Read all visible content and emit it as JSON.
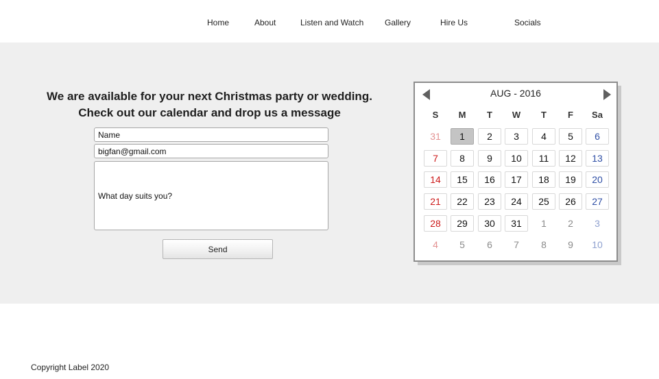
{
  "nav": {
    "items": [
      {
        "label": "Home"
      },
      {
        "label": "About"
      },
      {
        "label": "Listen and Watch"
      },
      {
        "label": "Gallery"
      },
      {
        "label": "Hire Us"
      },
      {
        "label": "Socials"
      }
    ]
  },
  "contact": {
    "headline_1": "We are available for your next Christmas party or wedding.",
    "headline_2": "Check out our calendar and drop us a message",
    "name_value": "Name",
    "email_value": "bigfan@gmail.com",
    "message_value": "What day suits you?",
    "send_label": "Send"
  },
  "calendar": {
    "title": "AUG - 2016",
    "prev_icon": "triangle-left-icon",
    "next_icon": "triangle-right-icon",
    "weekdays": [
      "S",
      "M",
      "T",
      "W",
      "T",
      "F",
      "Sa"
    ],
    "today": "1",
    "weeks": [
      [
        "31",
        "1",
        "2",
        "3",
        "4",
        "5",
        "6"
      ],
      [
        "7",
        "8",
        "9",
        "10",
        "11",
        "12",
        "13"
      ],
      [
        "14",
        "15",
        "16",
        "17",
        "18",
        "19",
        "20"
      ],
      [
        "21",
        "22",
        "23",
        "24",
        "25",
        "26",
        "27"
      ],
      [
        "28",
        "29",
        "30",
        "31",
        "1",
        "2",
        "3"
      ],
      [
        "4",
        "5",
        "6",
        "7",
        "8",
        "9",
        "10"
      ]
    ],
    "colors": {
      "sunday": "#cc1a1a",
      "saturday": "#2f4fa5",
      "today_bg": "#c4c4c4"
    }
  },
  "footer": {
    "copyright": "Copyright Label 2020"
  }
}
